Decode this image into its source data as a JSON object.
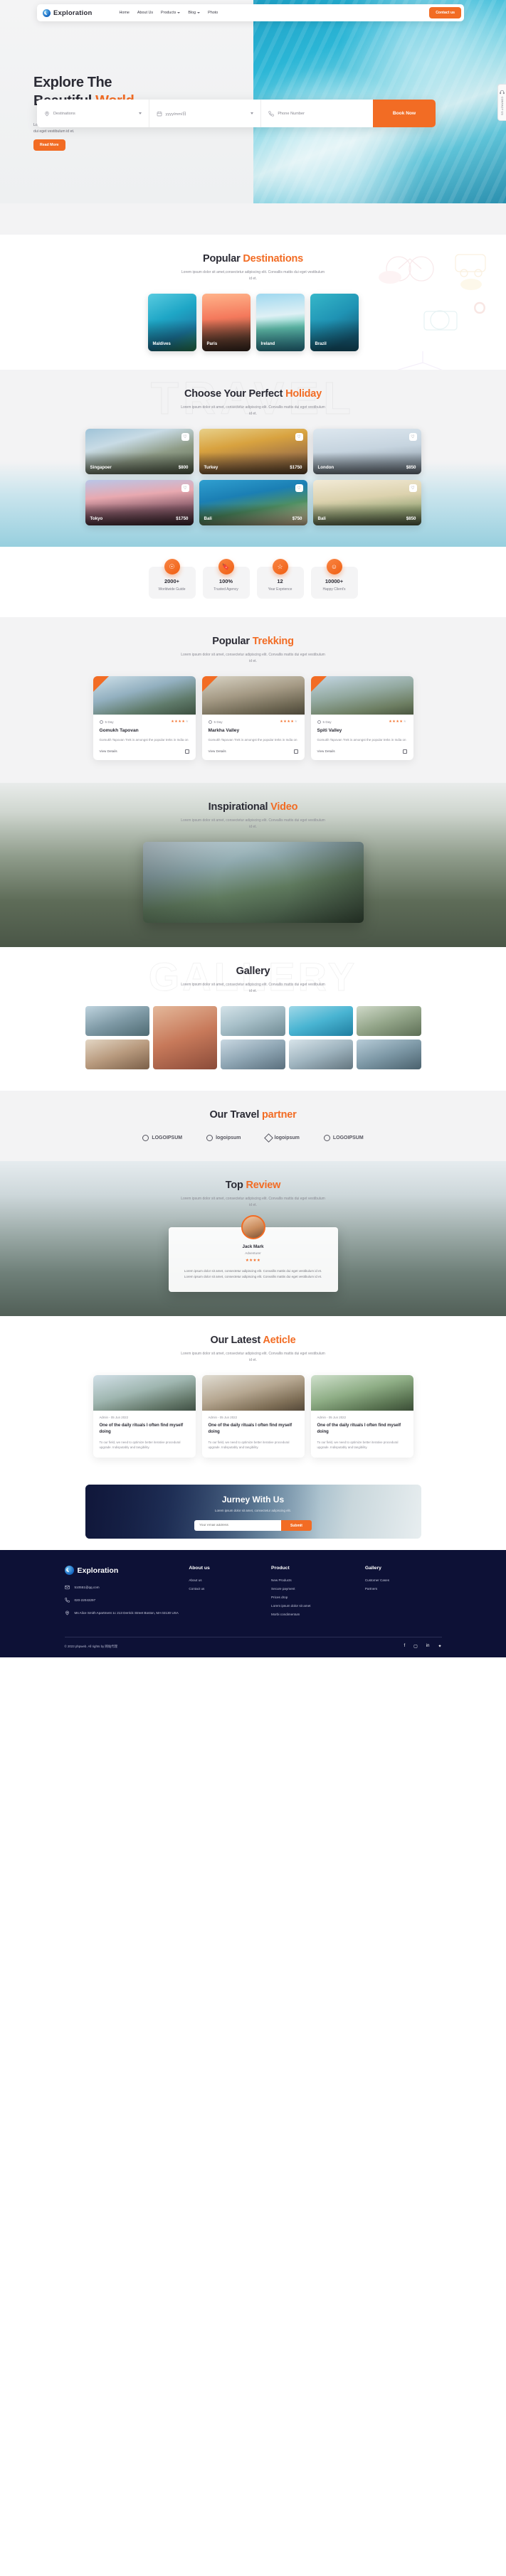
{
  "brand": {
    "name": "Exploration",
    "icon": "globe-icon"
  },
  "nav": {
    "items": [
      {
        "label": "Home",
        "dropdown": false
      },
      {
        "label": "About Us",
        "dropdown": false
      },
      {
        "label": "Products",
        "dropdown": true
      },
      {
        "label": "Blog",
        "dropdown": true
      },
      {
        "label": "Photo",
        "dropdown": false
      }
    ],
    "cta": "Contact us"
  },
  "hero": {
    "title_line1": "Explore The",
    "title_line2_plain": "Beautiful ",
    "title_line2_accent": "World",
    "subtitle": "Lorem ipsum dolor sit amet, consectetur adipiscing elit. Convallis mattis dui eget vestibulum id et.",
    "cta": "Read More"
  },
  "search": {
    "destination_value": "Destinations",
    "destination_icon": "location-pin-icon",
    "date_value": "yyyy/mm/日",
    "date_icon": "calendar-icon",
    "phone_placeholder": "Phone Number",
    "phone_icon": "phone-icon",
    "book_label": "Book Now"
  },
  "contact_tab": {
    "label": "CONTACT US",
    "icon": "headset-icon"
  },
  "destinations": {
    "title_plain": "Popular ",
    "title_accent": "Destinations",
    "subtitle": "Lorem ipsum dolor sit amet,consectetur adipiscing elit. Convallis mattis dui eget vestibulum id et.",
    "cards": [
      {
        "name": "Maldives"
      },
      {
        "name": "Paris"
      },
      {
        "name": "Ireland"
      },
      {
        "name": "Brazil"
      }
    ]
  },
  "holiday": {
    "watermark": "TRAVEL",
    "title_plain": "Choose Your Perfect ",
    "title_accent": "Holiday",
    "subtitle": "Lorem ipsum dolor sit amet, consectetur adipiscing elit. Convallis mattis dui eget vestibulum id et.",
    "cards": [
      {
        "name": "Singapoer",
        "price": "$800"
      },
      {
        "name": "Turkey",
        "price": "$1750"
      },
      {
        "name": "London",
        "price": "$850"
      },
      {
        "name": "Tokyo",
        "price": "$1750"
      },
      {
        "name": "Bali",
        "price": "$750"
      },
      {
        "name": "Bali",
        "price": "$850"
      }
    ],
    "favorite_icon": "heart-icon"
  },
  "stats": [
    {
      "value": "2000+",
      "label": "Worldwide Guide",
      "icon": "user-circle-icon"
    },
    {
      "value": "100%",
      "label": "Trusted Agency",
      "icon": "bookmark-icon"
    },
    {
      "value": "12",
      "label": "Year Exprience",
      "icon": "star-icon"
    },
    {
      "value": "10000+",
      "label": "Happy Client's",
      "icon": "smiley-icon"
    }
  ],
  "trekking": {
    "title_plain": "Popular ",
    "title_accent": "Trekking",
    "subtitle": "Lorem ipsum dolor sit amet, consectetur adipiscing elit. Convallis mattis dui eget vestibulum id et.",
    "cards": [
      {
        "duration": "5 Day",
        "rating": 4,
        "title": "Gomukh Tapovan",
        "excerpt": "Gomukh Tapovan Trek is amongst the popular treks in India on",
        "link": "View Details"
      },
      {
        "duration": "5 Day",
        "rating": 4,
        "title": "Markha Valley",
        "excerpt": "Gomukh Tapovan Trek is amongst the popular treks in India on",
        "link": "View Details"
      },
      {
        "duration": "5 Day",
        "rating": 4,
        "title": "Spiti Valley",
        "excerpt": "Gomukh Tapovan Trek is amongst the popular treks in India on",
        "link": "View Details"
      }
    ]
  },
  "video": {
    "title_plain": "Inspirational ",
    "title_accent": "Video",
    "subtitle": "Lorem ipsum dolor sit amet, consectetur adipiscing elit. Convallis mattis dui eget vestibulum id et."
  },
  "gallery": {
    "watermark": "GALLERY",
    "title": "Gallery",
    "subtitle": "Lorem ipsum dolor sit amet, consectetur adipiscing elit. Convallis mattis dui eget vestibulum id et.",
    "items": 9
  },
  "partners": {
    "title_plain": "Our Travel ",
    "title_accent": "partner",
    "logos": [
      {
        "label": "LOGOIPSUM",
        "mark": "pin-mark"
      },
      {
        "label": "logoipsum",
        "mark": "circle-slash-mark"
      },
      {
        "label": "logoipsum",
        "mark": "diamond-mark"
      },
      {
        "label": "LOGOIPSUM",
        "mark": "pin-mark"
      }
    ]
  },
  "review": {
    "title_plain": "Top ",
    "title_accent": "Review",
    "subtitle": "Lorem ipsum dolor sit amet, consectetur adipiscing elit. Convallis mattis dui eget vestibulum id et.",
    "name": "Jack Mark",
    "role": "Adventurer",
    "rating": 4,
    "quote": "Lorem ipsum dolor sit amet, consectetur adipiscing elit. Convallis mattis dui eget vestibulum id et. Lorem ipsum dolor sit amet, consectetur adipiscing elit. Convallis mattis dui eget vestibulum id et.",
    "avatar_icon": "avatar-icon"
  },
  "articles": {
    "title_plain": "Our Latest ",
    "title_accent": "Aeticle",
    "subtitle": "Lorem ipsum dolor sit amet, consectetur adipiscing elit. Convallis mattis dui eget vestibulum id et.",
    "cards": [
      {
        "date": "Admin - 05 Jun 2022",
        "title": "One of the daily rituals I often find myself doing",
        "excerpt": "To our field, we need to optimize better iterative procedural upgrade. Indisputably and tangibility."
      },
      {
        "date": "Admin - 05 Jun 2022",
        "title": "One of the daily rituals I often find myself doing",
        "excerpt": "To our field, we need to optimize better iterative procedural upgrade. Indisputably and tangibility."
      },
      {
        "date": "Admin - 05 Jun 2022",
        "title": "One of the daily rituals I often find myself doing",
        "excerpt": "To our field, we need to optimize better iterative procedural upgrade. Indisputably and tangibility."
      }
    ]
  },
  "newsletter": {
    "title": "Jurney With Us",
    "subtitle": "Lorem ipsum dolor sit amet, consectetur adipiscing elit.",
    "placeholder": "Your email address",
    "button": "Submit"
  },
  "footer": {
    "brand": "Exploration",
    "contacts": [
      {
        "icon": "mail-icon",
        "text": "510551@qq.com"
      },
      {
        "icon": "phone-icon",
        "text": "020-22043297"
      },
      {
        "icon": "location-pin-icon",
        "text": "Ms Alice Smith Apartment 1c 213 Derrick Street Boston, MA 02130 USA"
      }
    ],
    "columns": [
      {
        "heading": "About us",
        "links": [
          "About us",
          "Contact us"
        ]
      },
      {
        "heading": "Product",
        "links": [
          "New Products",
          "Secure payment",
          "Prices drop",
          "Lorem ipsum dolor sit amet",
          "Morbi condimentum"
        ]
      },
      {
        "heading": "Gallery",
        "links": [
          "Customer Cases",
          "Partners"
        ]
      }
    ],
    "copyright": "© 2023 phpweb. All rights by 网站代理",
    "socials": [
      "facebook-icon",
      "instagram-icon",
      "linkedin-icon",
      "twitter-icon"
    ]
  },
  "colors": {
    "accent": "#f26c24",
    "footer_bg": "#0d1136",
    "dark": "#2b2b35"
  }
}
